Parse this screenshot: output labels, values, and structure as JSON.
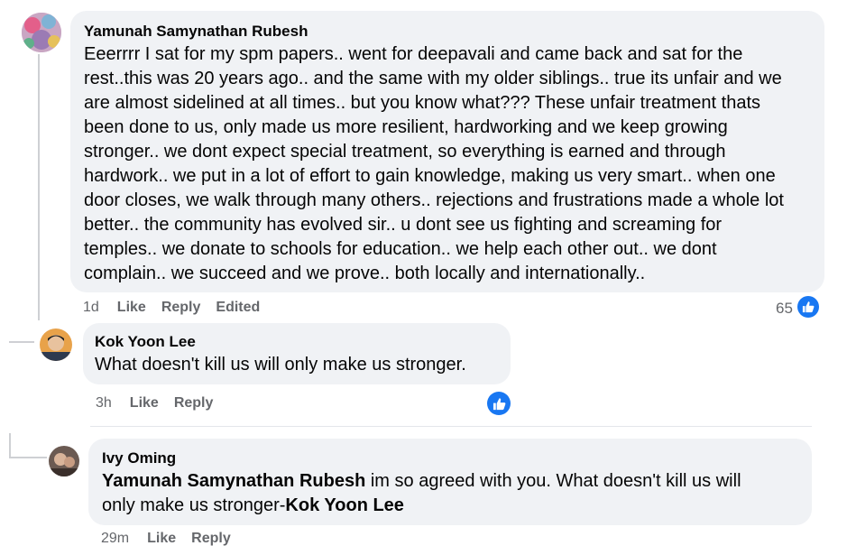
{
  "comments": [
    {
      "author": "Yamunah Samynathan Rubesh",
      "lines": [
        "Eeerrrr I sat for my spm papers.. went for deepavali and came back and sat for the",
        "rest..this was 20 years ago.. and the same with my older siblings.. true its unfair and we",
        "are almost sidelined at all times.. but you know what??? These unfair treatment thats",
        "been done to us, only made us more resilient, hardworking and we keep growing",
        "stronger.. we dont expect special treatment, so everything is earned and through",
        "hardwork.. we put in a lot of effort to gain knowledge, making us very smart.. when one",
        "door closes, we walk through many others.. rejections and frustrations made a whole lot",
        "better.. the community has evolved sir.. u dont see us fighting and screaming for",
        "temples.. we donate to schools for education.. we help each other out.. we dont",
        "complain.. we succeed and we prove.. both locally and internationally.."
      ],
      "time": "1d",
      "like": "Like",
      "reply": "Reply",
      "edited": "Edited",
      "reaction_count": "65"
    },
    {
      "author": "Kok Yoon Lee",
      "text": "What doesn't kill us will only make us stronger.",
      "time": "3h",
      "like": "Like",
      "reply": "Reply"
    },
    {
      "author": "Ivy Oming",
      "mention": "Yamunah Samynathan Rubesh",
      "text_line1": " im so agreed with you. What doesn't kill us will",
      "text_line2": "only make us stronger-",
      "mention2": "Kok Yoon Lee",
      "time": "29m",
      "like": "Like",
      "reply": "Reply"
    }
  ],
  "colors": {
    "bubble": "#f0f2f5",
    "meta": "#65676b",
    "like_blue": "#1877f2",
    "thread_line": "#ced0d4"
  },
  "icons": {
    "reaction": "thumbs-up-icon"
  }
}
